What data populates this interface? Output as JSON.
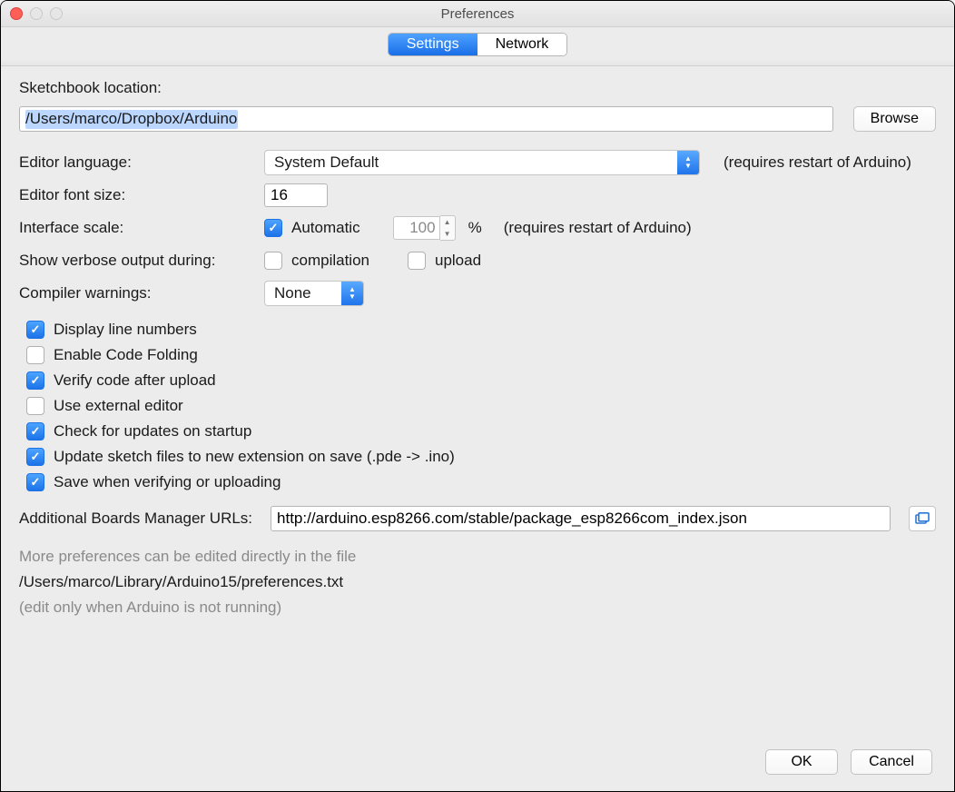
{
  "window": {
    "title": "Preferences"
  },
  "tabs": {
    "settings": "Settings",
    "network": "Network",
    "active": "settings"
  },
  "sketchbook": {
    "label": "Sketchbook location:",
    "path": "/Users/marco/Dropbox/Arduino",
    "browse": "Browse"
  },
  "editor_language": {
    "label": "Editor language:",
    "value": "System Default",
    "hint": "(requires restart of Arduino)"
  },
  "editor_font_size": {
    "label": "Editor font size:",
    "value": "16"
  },
  "interface_scale": {
    "label": "Interface scale:",
    "automatic_label": "Automatic",
    "automatic_checked": true,
    "value": "100",
    "percent": "%",
    "hint": "(requires restart of Arduino)"
  },
  "verbose": {
    "label": "Show verbose output during:",
    "compilation_label": "compilation",
    "compilation_checked": false,
    "upload_label": "upload",
    "upload_checked": false
  },
  "compiler_warnings": {
    "label": "Compiler warnings:",
    "value": "None"
  },
  "options": {
    "display_line_numbers": {
      "label": "Display line numbers",
      "checked": true
    },
    "enable_code_folding": {
      "label": "Enable Code Folding",
      "checked": false
    },
    "verify_after_upload": {
      "label": "Verify code after upload",
      "checked": true
    },
    "use_external_editor": {
      "label": "Use external editor",
      "checked": false
    },
    "check_updates": {
      "label": "Check for updates on startup",
      "checked": true
    },
    "update_extension": {
      "label": "Update sketch files to new extension on save (.pde -> .ino)",
      "checked": true
    },
    "save_when_verifying": {
      "label": "Save when verifying or uploading",
      "checked": true
    }
  },
  "boards_urls": {
    "label": "Additional Boards Manager URLs:",
    "value": "http://arduino.esp8266.com/stable/package_esp8266com_index.json"
  },
  "more_prefs": {
    "line1": "More preferences can be edited directly in the file",
    "path": "/Users/marco/Library/Arduino15/preferences.txt",
    "line2": "(edit only when Arduino is not running)"
  },
  "footer": {
    "ok": "OK",
    "cancel": "Cancel"
  }
}
